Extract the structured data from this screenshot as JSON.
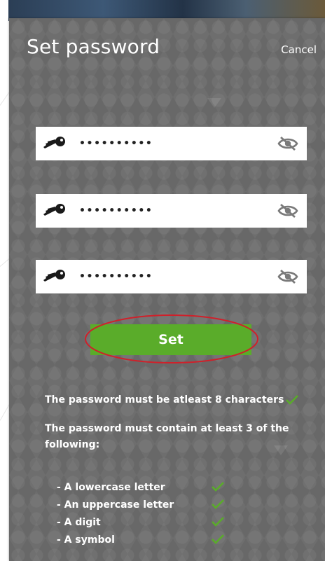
{
  "dialog": {
    "title": "Set password",
    "cancel_label": "Cancel"
  },
  "fields": [
    {
      "icon": "key-icon",
      "masked_value": "••••••••••",
      "toggle_icon": "eye-slash-icon"
    },
    {
      "icon": "key-icon",
      "masked_value": "••••••••••",
      "toggle_icon": "eye-slash-icon"
    },
    {
      "icon": "key-icon",
      "masked_value": "••••••••••",
      "toggle_icon": "eye-slash-icon"
    }
  ],
  "submit": {
    "label": "Set",
    "color": "#5aac2a",
    "annotation_color": "#d0202a"
  },
  "rules": {
    "length_rule": "The password must be atleast 8 characters",
    "complexity_rule": "The password must contain at least 3 of the following:",
    "items": [
      "- A lowercase letter",
      "- An uppercase letter",
      "- A digit",
      "- A symbol"
    ],
    "check_icon": "check-icon",
    "check_color": "#5aac2a"
  }
}
